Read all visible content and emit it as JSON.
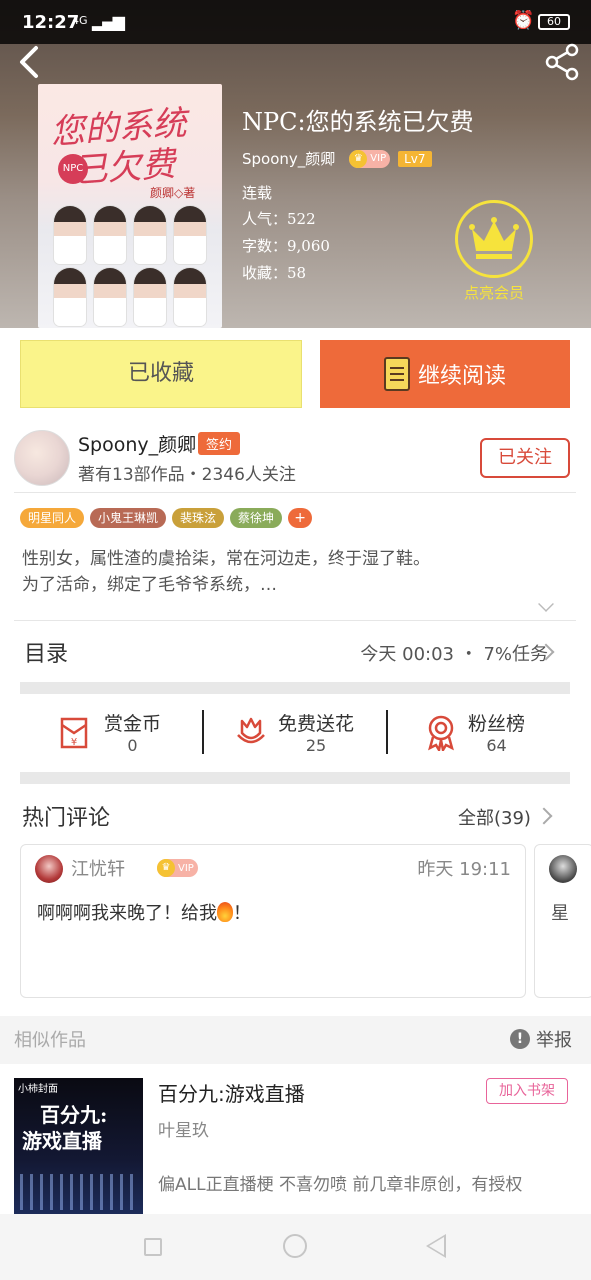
{
  "status_bar": {
    "time": "12:27",
    "network": "4G",
    "battery": "60"
  },
  "book": {
    "title": "NPC:您的系统已欠费",
    "author": "Spoony_颜卿",
    "vip_text": "VIP",
    "level": "Lv7",
    "status": "连载",
    "popularity": "人气：522",
    "word_count": "字数：9,060",
    "favorites": "收藏：58",
    "cover_title": "您的系统\n已欠费",
    "cover_author": "颜卿◇著",
    "cover_badge": "NPC"
  },
  "vip_member": {
    "label": "点亮会员"
  },
  "actions": {
    "favorited_label": "已收藏",
    "continue_label": "继续阅读"
  },
  "author_info": {
    "name": "Spoony_颜卿",
    "badge": "签约",
    "stats": "著有13部作品・2346人关注",
    "follow_label": "已关注"
  },
  "tags": [
    {
      "label": "明星同人",
      "color": "#f5a83a"
    },
    {
      "label": "小鬼王琳凯",
      "color": "#b86a55"
    },
    {
      "label": "裴珠泫",
      "color": "#c9a03a"
    },
    {
      "label": "蔡徐坤",
      "color": "#8aab5a"
    }
  ],
  "tag_add": "+",
  "description": {
    "line1": "性别女，属性渣的虞拾柒，常在河边走，终于湿了鞋。",
    "line2": "为了活命，绑定了毛爷爷系统，…"
  },
  "toc": {
    "label": "目录",
    "update": "今天 00:03 ・ 7%任务"
  },
  "stats": [
    {
      "label": "赏金币",
      "value": "0",
      "icon": "red-envelope-icon"
    },
    {
      "label": "免费送花",
      "value": "25",
      "icon": "flower-icon"
    },
    {
      "label": "粉丝榜",
      "value": "64",
      "icon": "medal-icon"
    }
  ],
  "hot_comments": {
    "title": "热门评论",
    "all_label": "全部(39)",
    "items": [
      {
        "user": "江忧轩",
        "vip": "VIP",
        "time": "昨天 19:11",
        "text": "啊啊啊我来晚了！给我",
        "text_end": "！"
      },
      {
        "user": "星"
      }
    ]
  },
  "similar": {
    "title": "相似作品",
    "report_label": "举报",
    "items": [
      {
        "title": "百分九:游戏直播",
        "author": "叶星玖",
        "desc": "偏ALL正直播梗 不喜勿喷 前几章非原创，有授权",
        "add_label": "加入书架",
        "cover_small": "小柿封面",
        "cover_title": "百分九:\n游戏直播"
      }
    ]
  },
  "colors": {
    "accent_orange": "#ee6a3a",
    "fav_yellow": "#faf48a",
    "vip_gold": "#f6e33c",
    "follow_red": "#d84a3a",
    "shelf_pink": "#e8649a"
  }
}
